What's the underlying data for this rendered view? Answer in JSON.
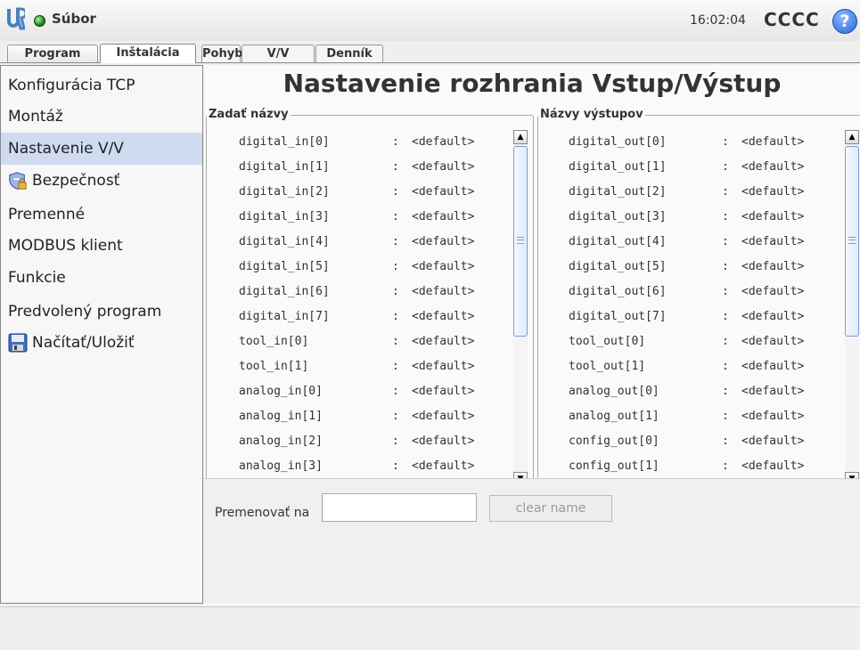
{
  "header": {
    "file_label": "Súbor",
    "clock": "16:02:04",
    "robot_name": "CCCC",
    "help_symbol": "?",
    "logo_icon": "ur-logo-icon",
    "status_icon": "status-green-dot-icon"
  },
  "tabs": [
    "Program",
    "Inštalácia",
    "Pohyb",
    "V/V",
    "Denník"
  ],
  "active_tab": "Inštalácia",
  "sidebar": {
    "items": [
      {
        "label": "Konfigurácia TCP"
      },
      {
        "label": "Montáž"
      },
      {
        "label": "Nastavenie V/V",
        "selected": true
      },
      {
        "label": "Bezpečnosť",
        "icon": "shield-lock-icon"
      },
      {
        "label": "Premenné"
      },
      {
        "label": "MODBUS klient"
      },
      {
        "label": "Funkcie"
      },
      {
        "label": "Predvolený program"
      },
      {
        "label": "Načítať/Uložiť",
        "icon": "save-disk-icon"
      }
    ]
  },
  "main": {
    "title": "Nastavenie rozhrania Vstup/Výstup",
    "inputs": {
      "title": "Zadať názvy",
      "separator": ":",
      "rows": [
        {
          "name": "digital_in[0]",
          "value": "<default>"
        },
        {
          "name": "digital_in[1]",
          "value": "<default>"
        },
        {
          "name": "digital_in[2]",
          "value": "<default>"
        },
        {
          "name": "digital_in[3]",
          "value": "<default>"
        },
        {
          "name": "digital_in[4]",
          "value": "<default>"
        },
        {
          "name": "digital_in[5]",
          "value": "<default>"
        },
        {
          "name": "digital_in[6]",
          "value": "<default>"
        },
        {
          "name": "digital_in[7]",
          "value": "<default>"
        },
        {
          "name": "tool_in[0]",
          "value": "<default>"
        },
        {
          "name": "tool_in[1]",
          "value": "<default>"
        },
        {
          "name": "analog_in[0]",
          "value": "<default>"
        },
        {
          "name": "analog_in[1]",
          "value": "<default>"
        },
        {
          "name": "analog_in[2]",
          "value": "<default>"
        },
        {
          "name": "analog_in[3]",
          "value": "<default>"
        }
      ]
    },
    "outputs": {
      "title": "Názvy výstupov",
      "separator": ":",
      "rows": [
        {
          "name": "digital_out[0]",
          "value": "<default>"
        },
        {
          "name": "digital_out[1]",
          "value": "<default>"
        },
        {
          "name": "digital_out[2]",
          "value": "<default>"
        },
        {
          "name": "digital_out[3]",
          "value": "<default>"
        },
        {
          "name": "digital_out[4]",
          "value": "<default>"
        },
        {
          "name": "digital_out[5]",
          "value": "<default>"
        },
        {
          "name": "digital_out[6]",
          "value": "<default>"
        },
        {
          "name": "digital_out[7]",
          "value": "<default>"
        },
        {
          "name": "tool_out[0]",
          "value": "<default>"
        },
        {
          "name": "tool_out[1]",
          "value": "<default>"
        },
        {
          "name": "analog_out[0]",
          "value": "<default>"
        },
        {
          "name": "analog_out[1]",
          "value": "<default>"
        },
        {
          "name": "config_out[0]",
          "value": "<default>"
        },
        {
          "name": "config_out[1]",
          "value": "<default>"
        }
      ]
    },
    "rename": {
      "label": "Premenovať na",
      "value": "",
      "clear_label": "clear name"
    }
  },
  "scrollbar_symbols": {
    "up": "▲",
    "down": "▼"
  }
}
